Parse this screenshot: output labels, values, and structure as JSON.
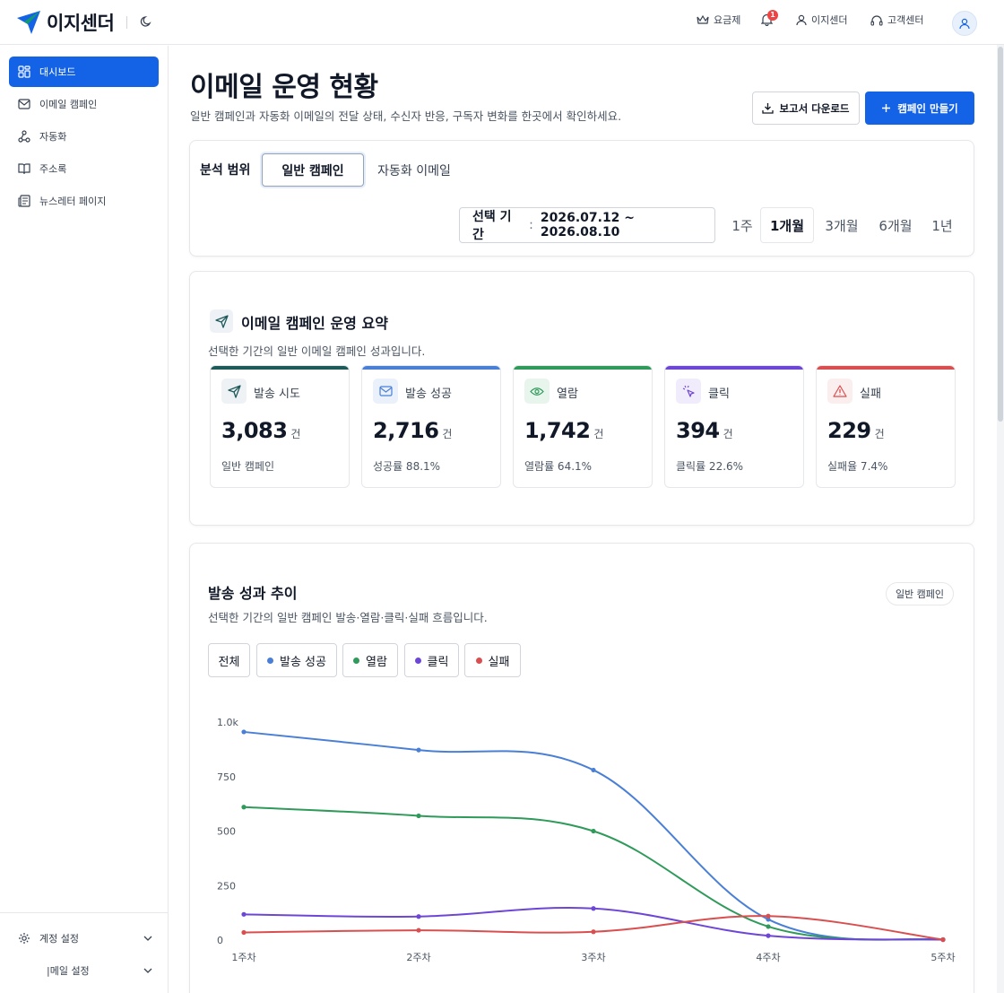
{
  "brand": {
    "name": "이지센더",
    "color": "#1463e6"
  },
  "topnav": {
    "pricing": "요금제",
    "notification_count": "1",
    "account": "이지센더",
    "support": "고객센터"
  },
  "sidebar": {
    "items": [
      {
        "label": "대시보드",
        "icon": "dashboard-grid-icon",
        "active": true
      },
      {
        "label": "이메일 캠페인",
        "icon": "mail-icon"
      },
      {
        "label": "자동화",
        "icon": "automation-workflow-icon"
      },
      {
        "label": "주소록",
        "icon": "book-icon"
      },
      {
        "label": "뉴스레터 페이지",
        "icon": "newspaper-icon"
      }
    ],
    "bottom": [
      {
        "label": "계정 설정",
        "icon": "gear-icon"
      },
      {
        "label": "|메일 설정",
        "icon": "mail-settings-icon"
      }
    ]
  },
  "page": {
    "title": "이메일 운영 현황",
    "description": "일반 캠페인과 자동화 이메일의 전달 상태, 수신자 반응, 구독자 변화를 한곳에서 확인하세요.",
    "download_button": "보고서 다운로드",
    "create_button": "캠페인 만들기"
  },
  "filter": {
    "scope_label": "분석 범위",
    "scope_tabs": [
      "일반 캠페인",
      "자동화 이메일"
    ],
    "scope_active": 0,
    "period_label": "선택 기간",
    "period_value": "2026.07.12 ~ 2026.08.10",
    "range_tabs": [
      "1주",
      "1개월",
      "3개월",
      "6개월",
      "1년"
    ],
    "range_active": 1
  },
  "summary": {
    "title": "이메일 캠페인 운영 요약",
    "description": "선택한 기간의 일반 이메일 캠페인 성과입니다.",
    "metrics": [
      {
        "label": "발송 시도",
        "value": "3,083",
        "unit": "건",
        "sub": "일반 캠페인",
        "color": "#1f5a5a",
        "icon": "send-icon",
        "icon_bg": "#eef2f4"
      },
      {
        "label": "발송 성공",
        "value": "2,716",
        "unit": "건",
        "sub": "성공률 88.1%",
        "color": "#4a7fd6",
        "icon": "mail-check-icon",
        "icon_bg": "#eaf1fb"
      },
      {
        "label": "열람",
        "value": "1,742",
        "unit": "건",
        "sub": "열람률 64.1%",
        "color": "#2f9a5a",
        "icon": "eye-icon",
        "icon_bg": "#e8f5ed"
      },
      {
        "label": "클릭",
        "value": "394",
        "unit": "건",
        "sub": "클릭률 22.6%",
        "color": "#6d46d6",
        "icon": "cursor-click-icon",
        "icon_bg": "#f0ecfb"
      },
      {
        "label": "실패",
        "value": "229",
        "unit": "건",
        "sub": "실패율 7.4%",
        "color": "#d94f4f",
        "icon": "warning-icon",
        "icon_bg": "#fbeeee"
      }
    ]
  },
  "trend": {
    "title": "발송 성과 추이",
    "description": "선택한 기간의 일반 캠페인 발송·열람·클릭·실패 흐름입니다.",
    "badge": "일반 캠페인",
    "filter_all": "전체"
  },
  "chart_data": {
    "type": "line",
    "categories": [
      "1주차",
      "2주차",
      "3주차",
      "4주차",
      "5주차"
    ],
    "y_ticks": [
      "0",
      "250",
      "500",
      "750",
      "1.0k"
    ],
    "ylim": [
      0,
      1000
    ],
    "grid": false,
    "series": [
      {
        "name": "발송 성공",
        "color": "#4a7fd6",
        "values": [
          955,
          872,
          780,
          95,
          2
        ]
      },
      {
        "name": "열람",
        "color": "#2f9a5a",
        "values": [
          610,
          570,
          500,
          62,
          2
        ]
      },
      {
        "name": "클릭",
        "color": "#6d46d6",
        "values": [
          118,
          108,
          145,
          20,
          2
        ]
      },
      {
        "name": "실패",
        "color": "#d94f4f",
        "values": [
          35,
          45,
          38,
          110,
          2
        ]
      }
    ]
  }
}
